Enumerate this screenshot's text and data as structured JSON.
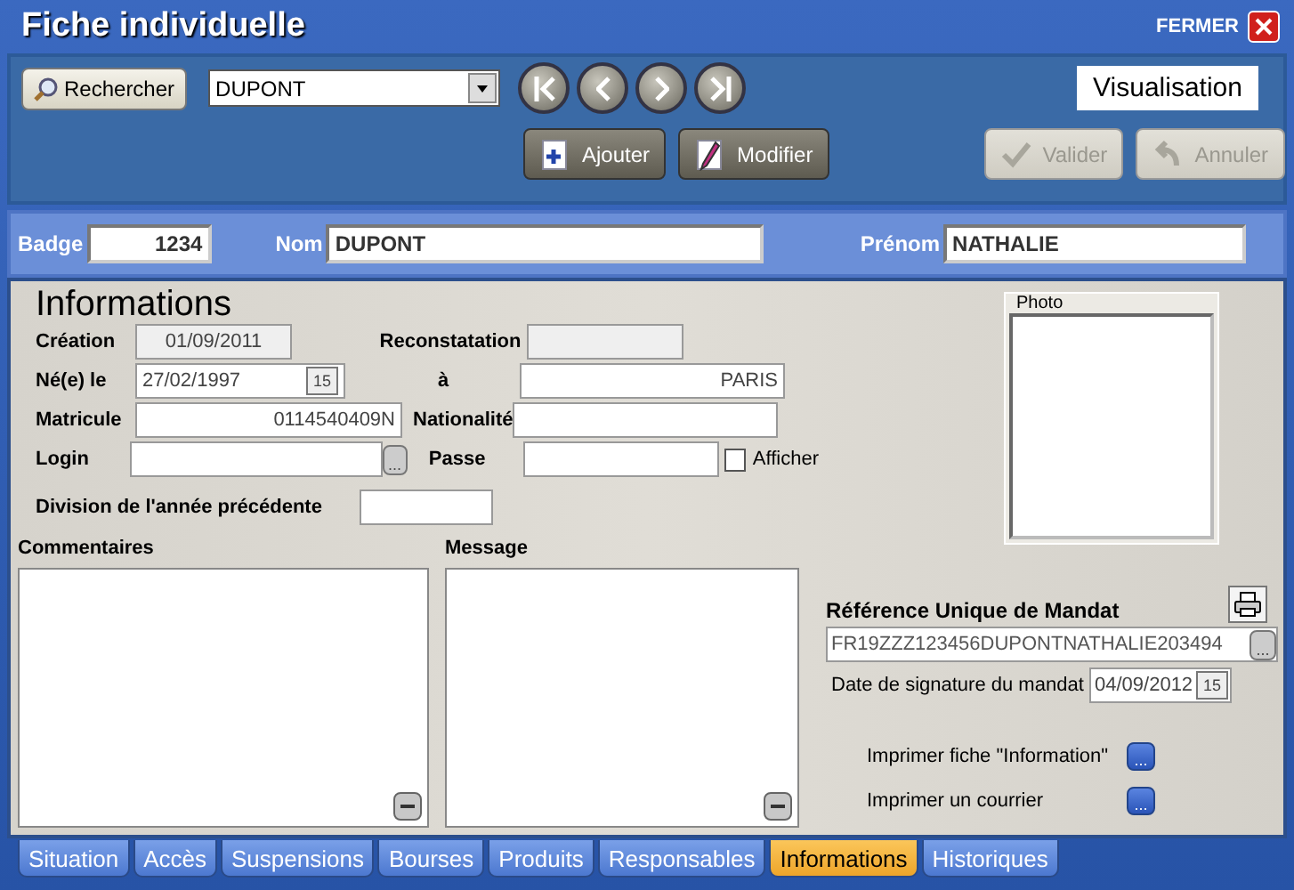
{
  "window": {
    "title": "Fiche individuelle",
    "close_label": "FERMER"
  },
  "toolbar": {
    "search_label": "Rechercher",
    "combo_value": "DUPONT",
    "mode": "Visualisation",
    "nav": [
      {
        "kind": "first"
      },
      {
        "kind": "prev"
      },
      {
        "kind": "next"
      },
      {
        "kind": "last"
      }
    ],
    "actions": [
      {
        "label": "Ajouter",
        "kind": "add",
        "disabled": false
      },
      {
        "label": "Modifier",
        "kind": "edit",
        "disabled": false
      },
      {
        "label": "Valider",
        "kind": "check",
        "disabled": true
      },
      {
        "label": "Annuler",
        "kind": "undo",
        "disabled": true
      }
    ]
  },
  "header": {
    "badge": {
      "label": "Badge",
      "value": "1234"
    },
    "nom": {
      "label": "Nom",
      "value": "DUPONT"
    },
    "prenom": {
      "label": "Prénom",
      "value": "NATHALIE"
    }
  },
  "info": {
    "title": "Informations",
    "creation": {
      "label": "Création",
      "value": "01/09/2011",
      "disabled": true
    },
    "reconstatation": {
      "label": "Reconstatation",
      "disabled": true
    },
    "birth_date": {
      "label": "Né(e) le",
      "value": "27/02/1997",
      "calendar": "15",
      "disabled": false
    },
    "birth_place": {
      "label": "à",
      "value": "PARIS",
      "disabled": false
    },
    "matricule": {
      "label": "Matricule",
      "value": "0114540409N",
      "disabled": false
    },
    "nationalite": {
      "label": "Nationalité",
      "disabled": false
    },
    "login": {
      "label": "Login",
      "button": "...",
      "disabled": false
    },
    "passe": {
      "label": "Passe",
      "disabled": false
    },
    "afficher": {
      "label": "Afficher",
      "checked": false
    },
    "division": {
      "label": "Division de l'année précédente",
      "disabled": false
    }
  },
  "memos": [
    {
      "label": "Commentaires"
    },
    {
      "label": "Message"
    }
  ],
  "photo": {
    "label": "Photo"
  },
  "mandat": {
    "title": "Référence Unique de Mandat",
    "reference": "FR19ZZZ123456DUPONTNATHALIE203494",
    "reference_button": "...",
    "date_label": "Date de signature du mandat",
    "date": "04/09/2012",
    "calendar": "15",
    "prints": [
      {
        "label": "Imprimer fiche \"Information\"",
        "button": "..."
      },
      {
        "label": "Imprimer un courrier",
        "button": "..."
      }
    ]
  },
  "tabs": [
    {
      "label": "Situation",
      "selected": false
    },
    {
      "label": "Accès",
      "selected": false
    },
    {
      "label": "Suspensions",
      "selected": false
    },
    {
      "label": "Bourses",
      "selected": false
    },
    {
      "label": "Produits",
      "selected": false
    },
    {
      "label": "Responsables",
      "selected": false
    },
    {
      "label": "Informations",
      "selected": true
    },
    {
      "label": "Historiques",
      "selected": false
    }
  ]
}
